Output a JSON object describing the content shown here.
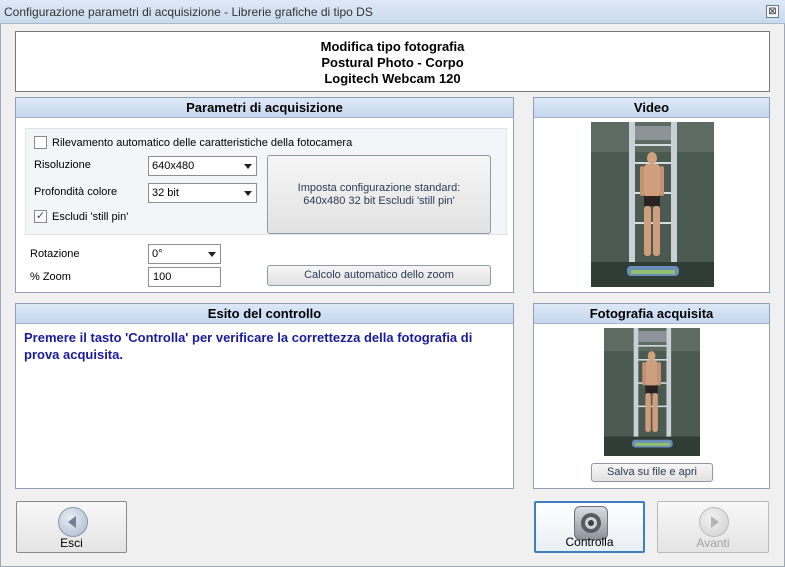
{
  "window": {
    "title": "Configurazione parametri di acquisizione - Librerie grafiche di tipo DS",
    "close_glyph": "⊠"
  },
  "header": {
    "line1": "Modifica tipo fotografia",
    "line2": "Postural Photo - Corpo",
    "line3": "Logitech Webcam 120"
  },
  "acquisition": {
    "title": "Parametri di acquisizione",
    "auto_detect_label": "Rilevamento automatico delle caratteristiche della fotocamera",
    "auto_detect_checked": false,
    "resolution_label": "Risoluzione",
    "resolution_value": "640x480",
    "color_depth_label": "Profondità colore",
    "color_depth_value": "32 bit",
    "exclude_still_pin_label": "Escludi 'still pin'",
    "exclude_still_pin_checked": true,
    "standard_config_line1": "Imposta configurazione standard:",
    "standard_config_line2": "640x480 32 bit Escludi 'still pin'",
    "rotation_label": "Rotazione",
    "rotation_value": "0°",
    "zoom_label": "% Zoom",
    "zoom_value": "100",
    "auto_zoom_label": "Calcolo automatico dello zoom"
  },
  "video": {
    "title": "Video"
  },
  "result": {
    "title": "Esito del controllo",
    "message": "Premere il tasto 'Controlla' per verificare la correttezza della fotografia di prova acquisita."
  },
  "photo": {
    "title": "Fotografia acquisita",
    "save_label": "Salva su file e apri"
  },
  "footer": {
    "exit_label": "Esci",
    "check_label": "Controlla",
    "next_label": "Avanti"
  },
  "icons": {
    "close": "close-icon",
    "back": "arrow-left-icon",
    "check": "camera-lens-icon",
    "next": "arrow-right-icon"
  },
  "colors": {
    "message_text": "#1a1aa0",
    "panel_header": "#c5d7ef",
    "check_button_border": "#3d7fc0"
  }
}
